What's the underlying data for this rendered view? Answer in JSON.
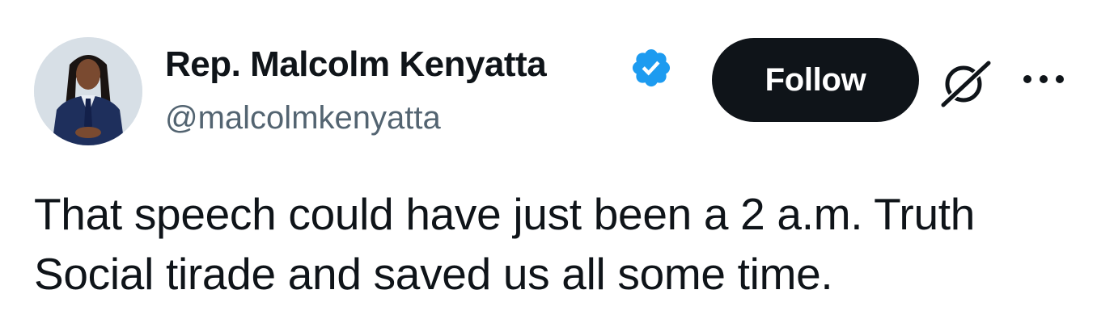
{
  "author": {
    "display_name": "Rep. Malcolm Kenyatta",
    "handle": "@malcolmkenyatta",
    "verified": true,
    "verified_color": "#1d9bf0"
  },
  "actions": {
    "follow_label": "Follow",
    "grok_icon": "grok-icon",
    "more_icon": "more-icon"
  },
  "tweet": {
    "text": "That speech could have just been a 2 a.m. Truth\nSocial tirade and saved us all some time."
  },
  "colors": {
    "text_primary": "#0f1419",
    "text_secondary": "#536471",
    "follow_button_bg": "#0f1419"
  }
}
